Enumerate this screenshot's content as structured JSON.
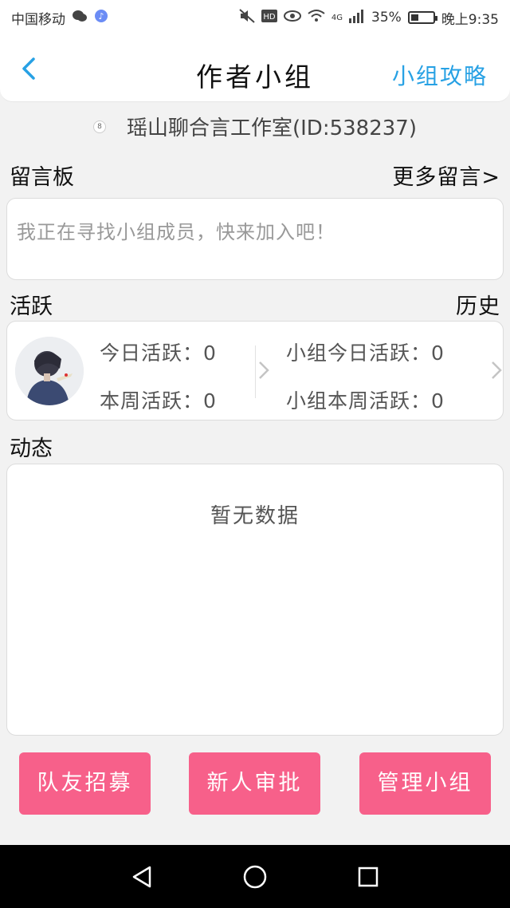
{
  "status_bar": {
    "carrier": "中国移动",
    "network": "4G",
    "battery": "35%",
    "time": "晚上9:35",
    "battery_level": 0.35
  },
  "header": {
    "title": "作者小组",
    "guide_link": "小组攻略"
  },
  "group": {
    "name": "瑶山聊合言工作室(ID:538237)"
  },
  "message_board": {
    "title": "留言板",
    "more": "更多留言>",
    "placeholder": "我正在寻找小组成员，快来加入吧！"
  },
  "activity": {
    "title": "活跃",
    "history": "历史",
    "today": "今日活跃：0",
    "week": "本周活跃：0",
    "group_today": "小组今日活跃：0",
    "group_week": "小组本周活跃：0"
  },
  "feed": {
    "title": "动态",
    "empty": "暂无数据"
  },
  "actions": {
    "recruit": "队友招募",
    "approve": "新人审批",
    "manage": "管理小组"
  },
  "colors": {
    "accent": "#27a1e4",
    "button": "#f7608a"
  }
}
